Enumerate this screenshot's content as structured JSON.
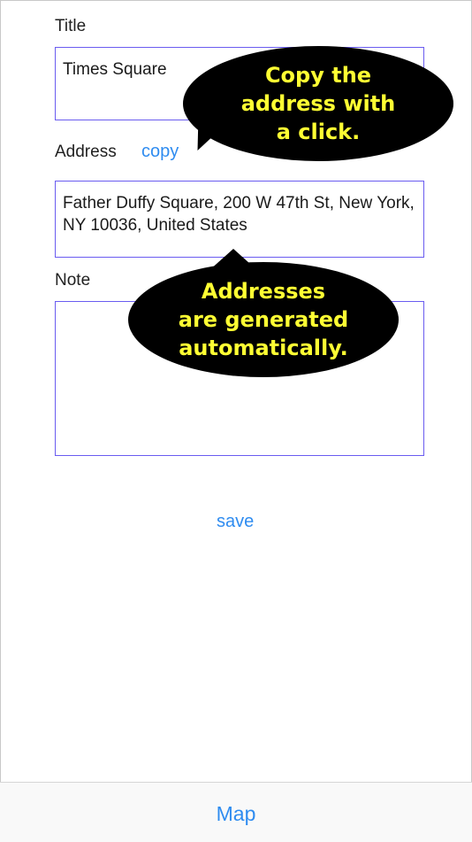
{
  "form": {
    "title_label": "Title",
    "title_value": "Times Square",
    "address_label": "Address",
    "copy_label": "copy",
    "address_value": "Father Duffy Square, 200 W 47th St, New York, NY  10036, United States",
    "note_label": "Note",
    "note_value": "",
    "save_label": "save"
  },
  "callouts": {
    "copy_hint": "Copy the\naddress with\na click.",
    "auto_hint": "Addresses\nare generated\nautomatically."
  },
  "tabbar": {
    "map_label": "Map"
  },
  "colors": {
    "accent": "#2f8cf0",
    "field_border": "#6a5cf0",
    "callout_bg": "#000000",
    "callout_text": "#ffff33"
  }
}
